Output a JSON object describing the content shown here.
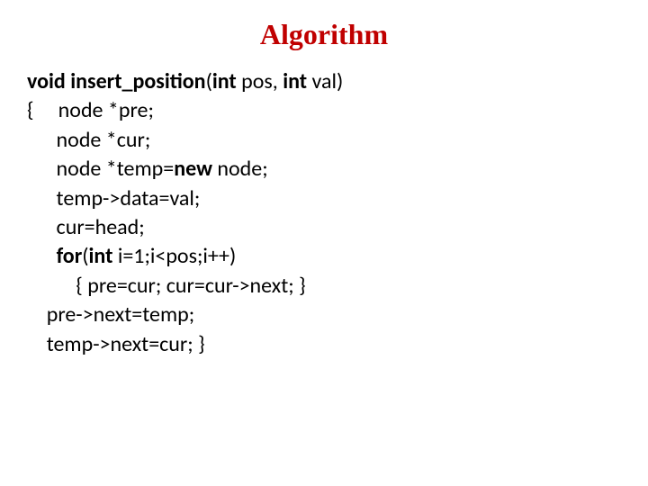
{
  "title": "Algorithm",
  "code": {
    "l1_a": "void insert_position",
    "l1_b": "(",
    "l1_c": "int",
    "l1_d": " pos, ",
    "l1_e": "int",
    "l1_f": " val)",
    "l2": "{     node *pre;",
    "l3": "      node *cur;",
    "l4_a": "      node *temp=",
    "l4_b": "new",
    "l4_c": " node;",
    "l5": "      temp->data=val;",
    "l6": "      cur=head;",
    "l7_a": "      ",
    "l7_b": "for",
    "l7_c": "(",
    "l7_d": "int",
    "l7_e": " i=1;i<pos;i++)",
    "l8": "          { pre=cur; cur=cur->next; }",
    "l9": "    pre->next=temp;",
    "l10": "    temp->next=cur; }"
  }
}
